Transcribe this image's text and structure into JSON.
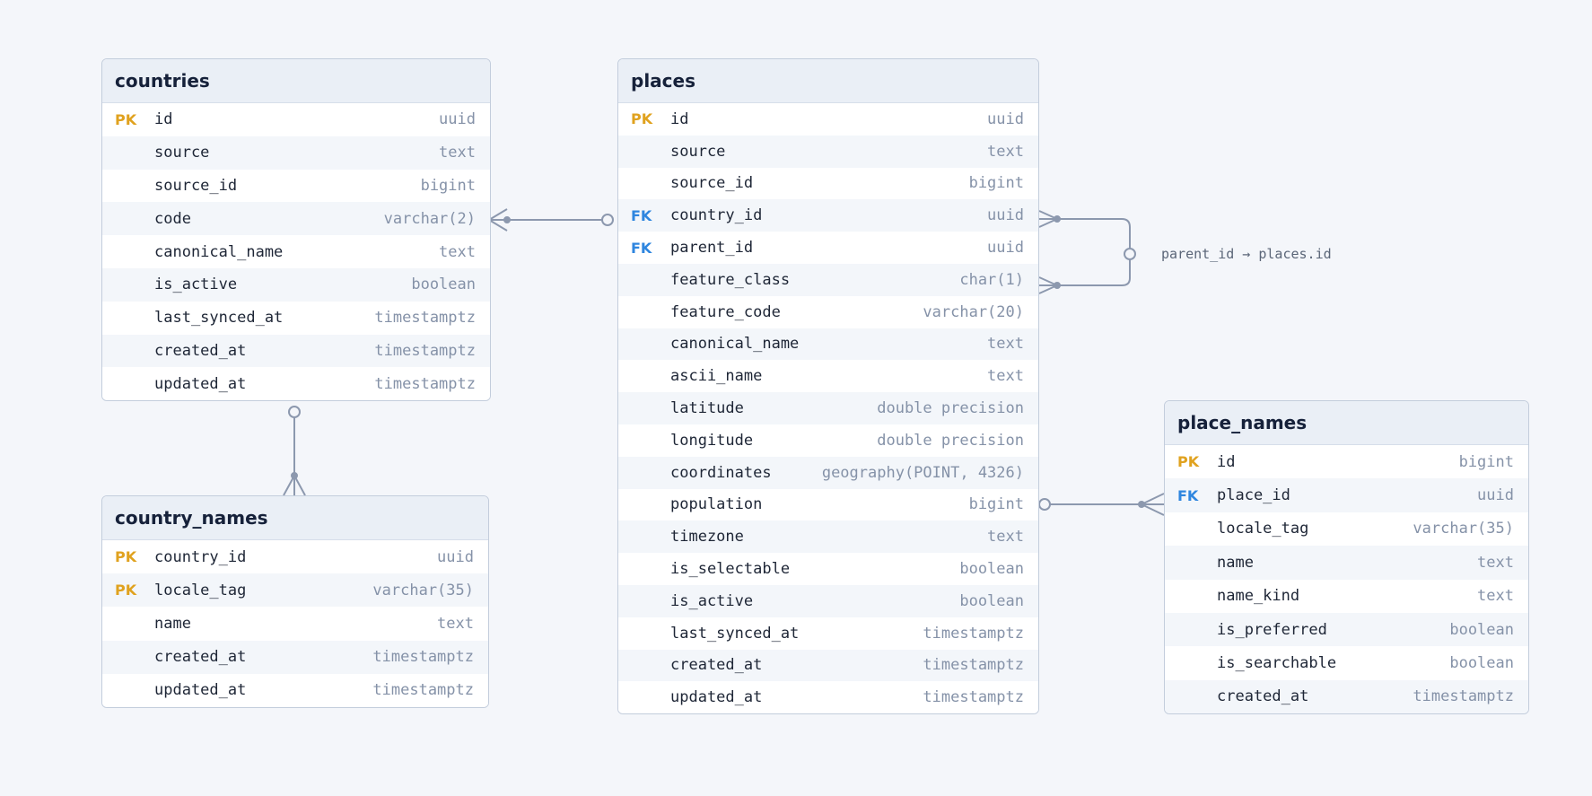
{
  "colors": {
    "background": "#f4f6fa",
    "header": "#eaeff6",
    "border": "#c3cddc",
    "pk": "#e0a21f",
    "fk": "#2f86df",
    "type_text": "#8592a8",
    "connector": "#8c98ae"
  },
  "tables": [
    {
      "id": "countries",
      "name": "countries",
      "columns": [
        {
          "key": "PK",
          "name": "id",
          "type": "uuid"
        },
        {
          "key": "",
          "name": "source",
          "type": "text"
        },
        {
          "key": "",
          "name": "source_id",
          "type": "bigint"
        },
        {
          "key": "",
          "name": "code",
          "type": "varchar(2)"
        },
        {
          "key": "",
          "name": "canonical_name",
          "type": "text"
        },
        {
          "key": "",
          "name": "is_active",
          "type": "boolean"
        },
        {
          "key": "",
          "name": "last_synced_at",
          "type": "timestamptz"
        },
        {
          "key": "",
          "name": "created_at",
          "type": "timestamptz"
        },
        {
          "key": "",
          "name": "updated_at",
          "type": "timestamptz"
        }
      ]
    },
    {
      "id": "country_names",
      "name": "country_names",
      "columns": [
        {
          "key": "PK",
          "name": "country_id",
          "type": "uuid"
        },
        {
          "key": "PK",
          "name": "locale_tag",
          "type": "varchar(35)"
        },
        {
          "key": "",
          "name": "name",
          "type": "text"
        },
        {
          "key": "",
          "name": "created_at",
          "type": "timestamptz"
        },
        {
          "key": "",
          "name": "updated_at",
          "type": "timestamptz"
        }
      ]
    },
    {
      "id": "places",
      "name": "places",
      "columns": [
        {
          "key": "PK",
          "name": "id",
          "type": "uuid"
        },
        {
          "key": "",
          "name": "source",
          "type": "text"
        },
        {
          "key": "",
          "name": "source_id",
          "type": "bigint"
        },
        {
          "key": "FK",
          "name": "country_id",
          "type": "uuid"
        },
        {
          "key": "FK",
          "name": "parent_id",
          "type": "uuid"
        },
        {
          "key": "",
          "name": "feature_class",
          "type": "char(1)"
        },
        {
          "key": "",
          "name": "feature_code",
          "type": "varchar(20)"
        },
        {
          "key": "",
          "name": "canonical_name",
          "type": "text"
        },
        {
          "key": "",
          "name": "ascii_name",
          "type": "text"
        },
        {
          "key": "",
          "name": "latitude",
          "type": "double precision"
        },
        {
          "key": "",
          "name": "longitude",
          "type": "double precision"
        },
        {
          "key": "",
          "name": "coordinates",
          "type": "geography(POINT, 4326)"
        },
        {
          "key": "",
          "name": "population",
          "type": "bigint"
        },
        {
          "key": "",
          "name": "timezone",
          "type": "text"
        },
        {
          "key": "",
          "name": "is_selectable",
          "type": "boolean"
        },
        {
          "key": "",
          "name": "is_active",
          "type": "boolean"
        },
        {
          "key": "",
          "name": "last_synced_at",
          "type": "timestamptz"
        },
        {
          "key": "",
          "name": "created_at",
          "type": "timestamptz"
        },
        {
          "key": "",
          "name": "updated_at",
          "type": "timestamptz"
        }
      ]
    },
    {
      "id": "place_names",
      "name": "place_names",
      "columns": [
        {
          "key": "PK",
          "name": "id",
          "type": "bigint"
        },
        {
          "key": "FK",
          "name": "place_id",
          "type": "uuid"
        },
        {
          "key": "",
          "name": "locale_tag",
          "type": "varchar(35)"
        },
        {
          "key": "",
          "name": "name",
          "type": "text"
        },
        {
          "key": "",
          "name": "name_kind",
          "type": "text"
        },
        {
          "key": "",
          "name": "is_preferred",
          "type": "boolean"
        },
        {
          "key": "",
          "name": "is_searchable",
          "type": "boolean"
        },
        {
          "key": "",
          "name": "created_at",
          "type": "timestamptz"
        }
      ]
    }
  ],
  "annotations": {
    "self_ref_label": "parent_id → places.id"
  }
}
